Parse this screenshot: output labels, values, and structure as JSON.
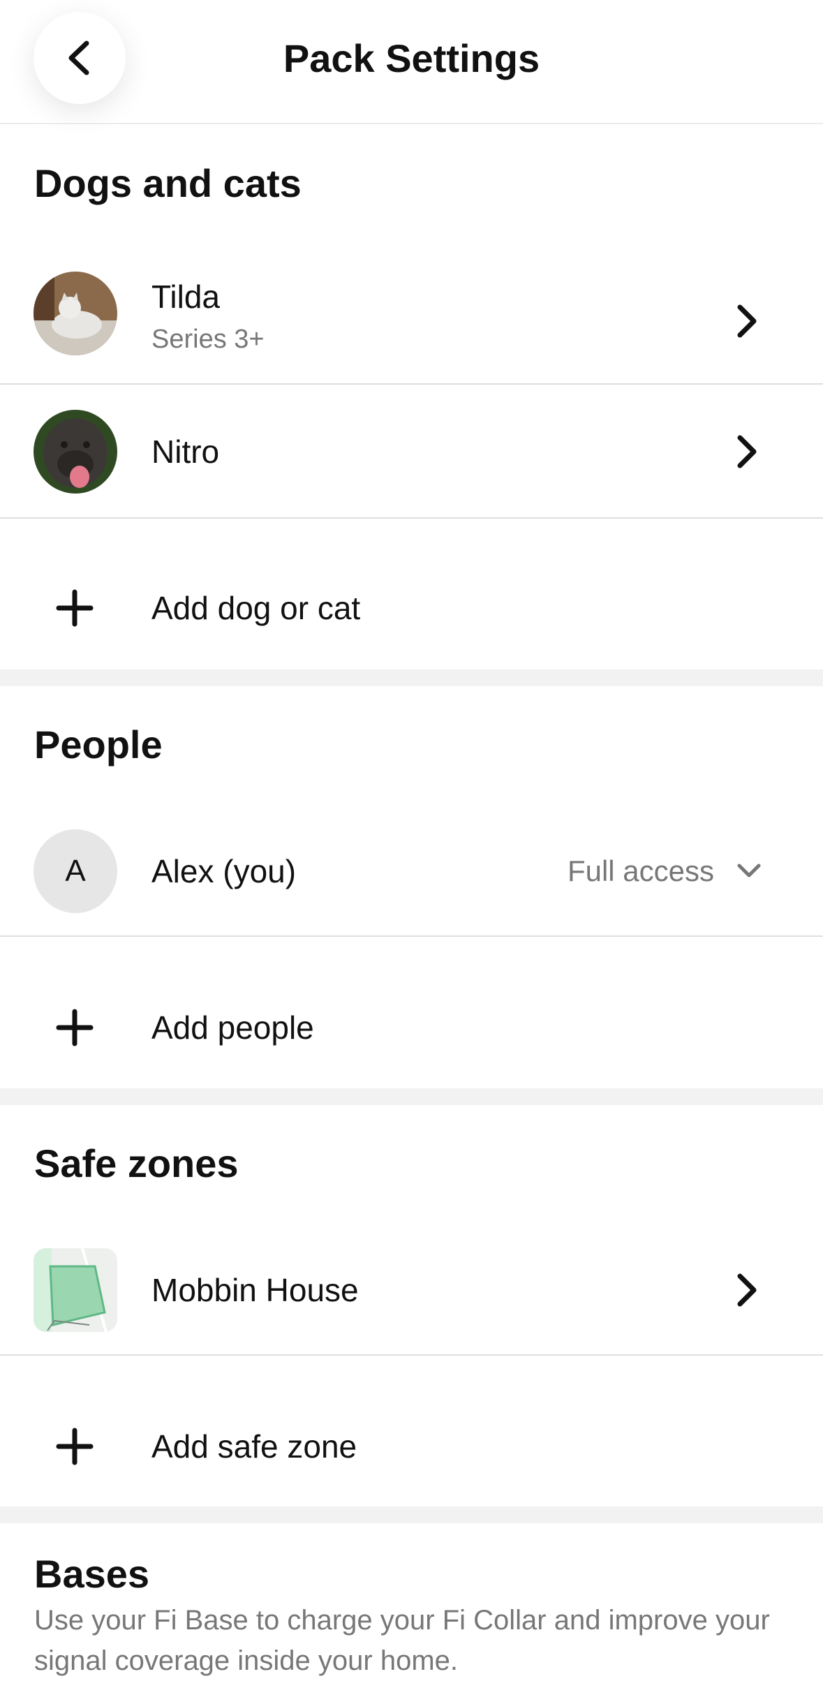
{
  "header": {
    "title": "Pack Settings",
    "back_icon": "chevron-left-icon"
  },
  "pets": {
    "section_title": "Dogs and cats",
    "items": [
      {
        "name": "Tilda",
        "subtitle": "Series 3+",
        "avatar": "cat-photo"
      },
      {
        "name": "Nitro",
        "subtitle": "",
        "avatar": "dog-photo"
      }
    ],
    "add_label": "Add dog or cat"
  },
  "people": {
    "section_title": "People",
    "items": [
      {
        "initial": "A",
        "name": "Alex (you)",
        "access": "Full access"
      }
    ],
    "add_label": "Add people"
  },
  "safe_zones": {
    "section_title": "Safe zones",
    "items": [
      {
        "name": "Mobbin House",
        "thumbnail": "map-thumbnail"
      }
    ],
    "add_label": "Add safe zone"
  },
  "bases": {
    "section_title": "Bases",
    "description": "Use your Fi Base to charge your Fi Collar and improve your signal coverage inside your home."
  },
  "colors": {
    "accent_map": "#9ad7b0",
    "separator": "#f2f2f2",
    "secondary_text": "#777777"
  }
}
